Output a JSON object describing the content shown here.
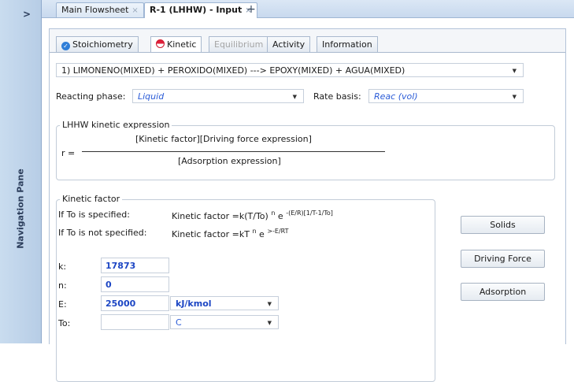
{
  "nav": {
    "arrow": ">",
    "label": "Navigation Pane"
  },
  "doc_tabs": [
    {
      "label": "Main Flowsheet",
      "close": "×"
    },
    {
      "label": "R-1 (LHHW) - Input",
      "close": "×"
    }
  ],
  "doc_add": "+",
  "sub_tabs": [
    {
      "label": "Stoichiometry"
    },
    {
      "label": "Kinetic"
    },
    {
      "label": "Equilibrium"
    },
    {
      "label": "Activity"
    },
    {
      "label": "Information"
    }
  ],
  "reaction": {
    "selected": "1) LIMONENO(MIXED)  + PEROXIDO(MIXED)  --->  EPOXY(MIXED) + AGUA(MIXED)"
  },
  "reacting_phase": {
    "label": "Reacting phase:",
    "value": "Liquid"
  },
  "rate_basis": {
    "label": "Rate basis:",
    "value": "Reac (vol)"
  },
  "lhhw": {
    "title": "LHHW kinetic expression",
    "r_label": "r =",
    "numerator": "[Kinetic factor][Driving force expression]",
    "denominator": "[Adsorption expression]"
  },
  "kinetic_factor": {
    "title": "Kinetic factor",
    "if_specified": "If To is specified:",
    "formula_specified": "Kinetic factor =k(T/To)",
    "sup_n1": "n",
    "e1": "e",
    "sup_exp1": "-(E/R)[1/T-1/To]",
    "if_not_specified": "If To is not specified:",
    "formula_not_specified": "Kinetic factor =kT",
    "sup_n2": "n",
    "e2": "e",
    "sup_exp2": ">-E/RT",
    "k_label": "k:",
    "k_value": "17873",
    "n_label": "n:",
    "n_value": "0",
    "E_label": "E:",
    "E_value": "25000",
    "E_unit": "kJ/kmol",
    "To_label": "To:",
    "To_value": "",
    "To_unit": "C"
  },
  "buttons": {
    "solids": "Solids",
    "driving_force": "Driving Force",
    "adsorption": "Adsorption"
  },
  "icons": {
    "dropdown": "chevron-down-icon",
    "check": "check-circle-icon",
    "kinetic": "half-circle-icon"
  },
  "colors": {
    "nav_pane": "#c9dcef",
    "link_blue": "#2a5bd7",
    "value_blue": "#1c46c4"
  }
}
